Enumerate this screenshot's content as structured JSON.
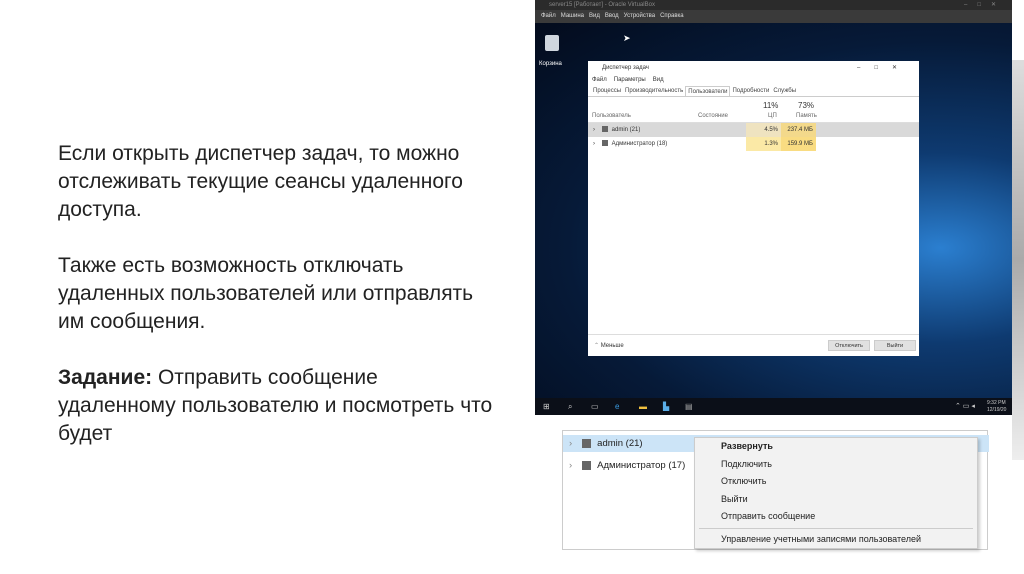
{
  "slide": {
    "para1": "Если открыть диспетчер задач, то можно отслеживать текущие сеансы удаленного доступа.",
    "para2": "Также есть возможность отключать удаленных пользователей или отправлять им сообщения.",
    "task_label": "Задание:",
    "task_text": " Отправить сообщение удаленному пользователю и посмотреть что будет"
  },
  "vm": {
    "title": "server15 [Работает] - Oracle VirtualBox",
    "menu": [
      "Файл",
      "Машина",
      "Вид",
      "Ввод",
      "Устройства",
      "Справка"
    ],
    "recycle_bin": "Корзина",
    "clock_time": "9:32 PM",
    "clock_date": "12/19/20"
  },
  "taskmgr": {
    "title": "Диспетчер задач",
    "menu": [
      "Файл",
      "Параметры",
      "Вид"
    ],
    "tabs": [
      "Процессы",
      "Производительность",
      "Пользователи",
      "Подробности",
      "Службы"
    ],
    "active_tab": "Пользователи",
    "columns": {
      "user": "Пользователь",
      "status": "Состояние",
      "cpu_pct": "11%",
      "cpu": "ЦП",
      "mem_pct": "73%",
      "mem": "Память"
    },
    "rows": [
      {
        "name": "admin (21)",
        "cpu": "4.5%",
        "mem": "237.4 МБ"
      },
      {
        "name": "Администратор (18)",
        "cpu": "1.3%",
        "mem": "159.9 МБ"
      }
    ],
    "less": "Меньше",
    "disconnect": "Отключить",
    "logout": "Выйти"
  },
  "context": {
    "rows": [
      "admin (21)",
      "Администратор (17)"
    ],
    "items": [
      "Развернуть",
      "Подключить",
      "Отключить",
      "Выйти",
      "Отправить сообщение"
    ],
    "manage": "Управление учетными записями пользователей"
  },
  "colors": {
    "cpu_highlight": "#fbe9a6",
    "mem_highlight": "#f9dc82",
    "selection": "#cce4f7"
  }
}
